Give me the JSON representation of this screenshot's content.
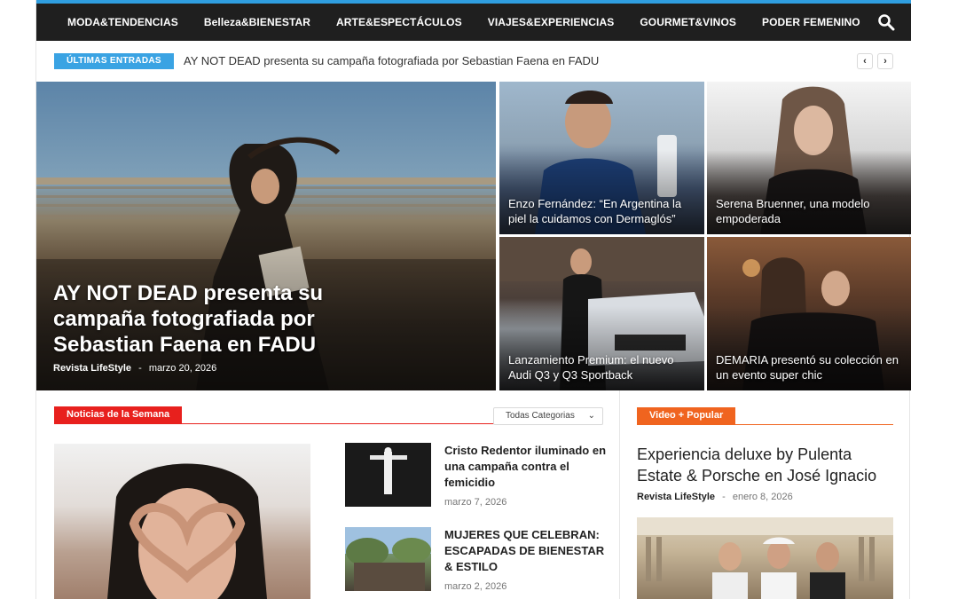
{
  "nav": {
    "items": [
      "MODA&TENDENCIAS",
      "Belleza&BIENESTAR",
      "ARTE&ESPECTÁCULOS",
      "VIAJES&EXPERIENCIAS",
      "GOURMET&VINOS",
      "PODER FEMENINO"
    ],
    "search_icon": "search-icon"
  },
  "ticker": {
    "label": "ÚLTIMAS ENTRADAS",
    "headline": "AY NOT DEAD presenta su campaña fotografiada por Sebastian Faena en FADU",
    "prev": "‹",
    "next": "›"
  },
  "hero": {
    "main": {
      "title": "AY NOT DEAD presenta su campaña fotografiada por Sebastian Faena en FADU",
      "author": "Revista LifeStyle",
      "separator": "-",
      "date": "marzo 20, 2026"
    },
    "tiles": [
      {
        "title": "Enzo Fernández: “En Argentina la piel la cuidamos con Dermaglós”"
      },
      {
        "title": "Serena Bruenner, una modelo empoderada"
      },
      {
        "title": "Lanzamiento Premium: el nuevo Audi Q3 y Q3 Sportback"
      },
      {
        "title": "DEMARIA presentó su colección en un evento super chic"
      }
    ]
  },
  "news": {
    "section_label": "Noticias de la Semana",
    "filter": "Todas Categorias",
    "items": [
      {
        "title": "Cristo Redentor iluminado en una campaña contra el femicidio",
        "date": "marzo 7, 2026"
      },
      {
        "title": "MUJERES QUE CELEBRAN: ESCAPADAS DE BIENESTAR & ESTILO",
        "date": "marzo 2, 2026"
      }
    ]
  },
  "video": {
    "section_label": "Video + Popular",
    "title": "Experiencia deluxe by Pulenta Estate & Porsche en José Ignacio",
    "author": "Revista LifeStyle",
    "separator": "-",
    "date": "enero 8, 2026"
  },
  "colors": {
    "accent_blue": "#2f9ee0",
    "nav_bg": "#1f1f1f",
    "news_red": "#e8201d",
    "video_orange": "#f0641f"
  }
}
